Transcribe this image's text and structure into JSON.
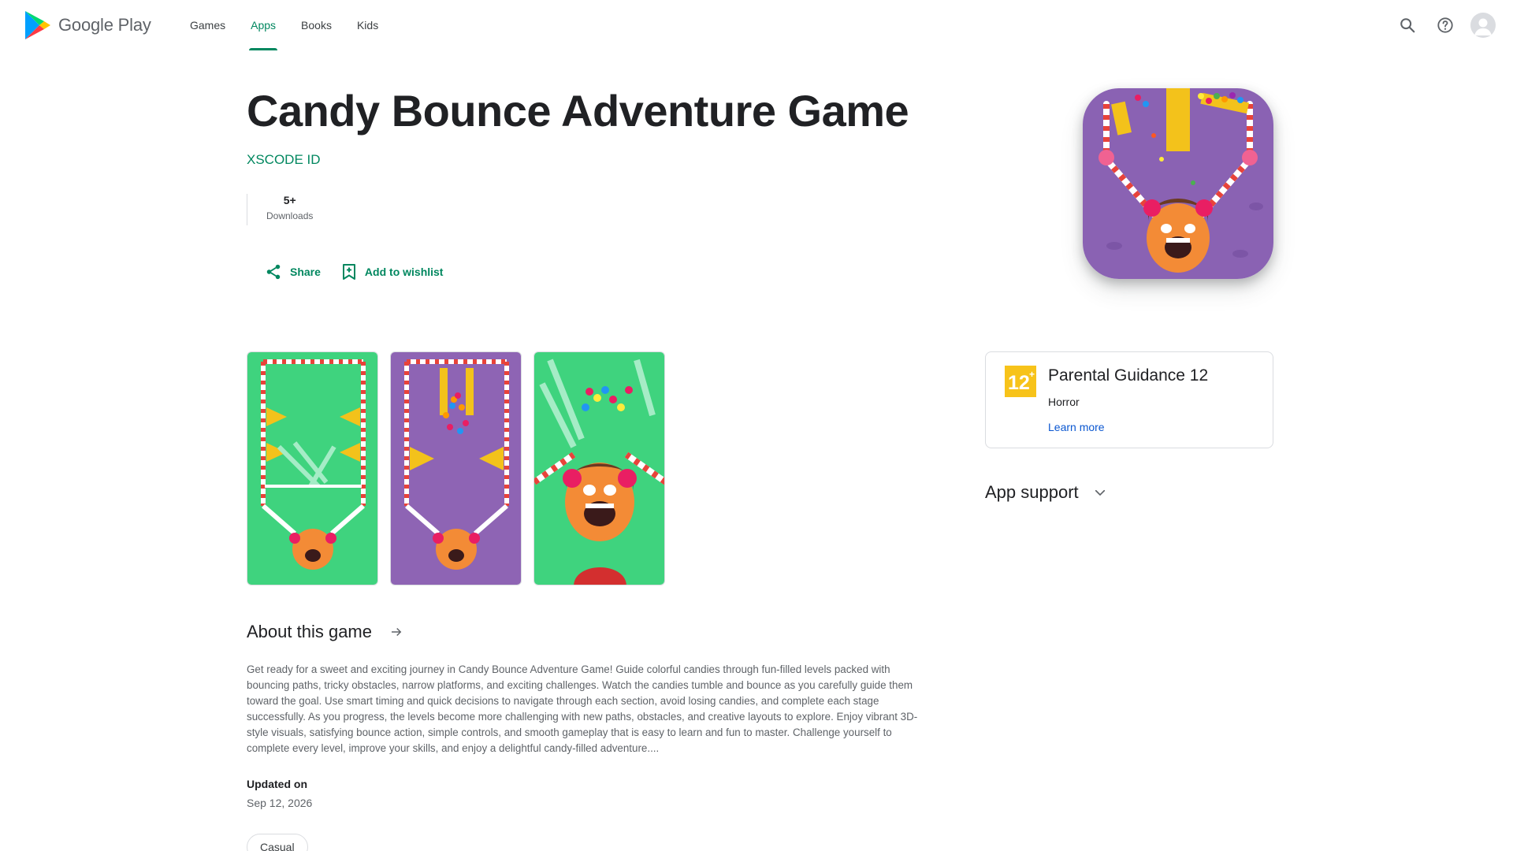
{
  "header": {
    "logo_text": "Google Play",
    "nav": [
      {
        "label": "Games"
      },
      {
        "label": "Apps",
        "active": true
      },
      {
        "label": "Books"
      },
      {
        "label": "Kids"
      }
    ],
    "icons": [
      "search-icon",
      "help-icon",
      "account-avatar"
    ]
  },
  "app": {
    "title": "Candy Bounce Adventure Game",
    "developer": "XSCODE ID",
    "downloads_value": "5+",
    "downloads_label": "Downloads",
    "share_label": "Share",
    "wishlist_label": "Add to wishlist"
  },
  "rating": {
    "badge_text": "12",
    "title": "Parental Guidance 12",
    "subtitle": "Horror",
    "link": "Learn more"
  },
  "app_support": {
    "label": "App support"
  },
  "about": {
    "title": "About this game",
    "description": "Get ready for a sweet and exciting journey in Candy Bounce Adventure Game! Guide colorful candies through fun-filled levels packed with bouncing paths, tricky obstacles, narrow platforms, and exciting challenges. Watch the candies tumble and bounce as you carefully guide them toward the goal. Use smart timing and quick decisions to navigate through each section, avoid losing candies, and complete each stage successfully. As you progress, the levels become more challenging with new paths, obstacles, and creative layouts to explore. Enjoy vibrant 3D-style visuals, satisfying bounce action, simple controls, and smooth gameplay that is easy to learn and fun to master. Challenge yourself to complete every level, improve your skills, and enjoy a delightful candy-filled adventure....",
    "updated_label": "Updated on",
    "updated_value": "Sep 12, 2026",
    "tag": "Casual"
  },
  "colors": {
    "accent": "#01875f",
    "link": "#0b57d0",
    "rating_badge": "#f7c31a",
    "screenshot_green": "#3fd37e",
    "screenshot_purple": "#8e64b4"
  }
}
